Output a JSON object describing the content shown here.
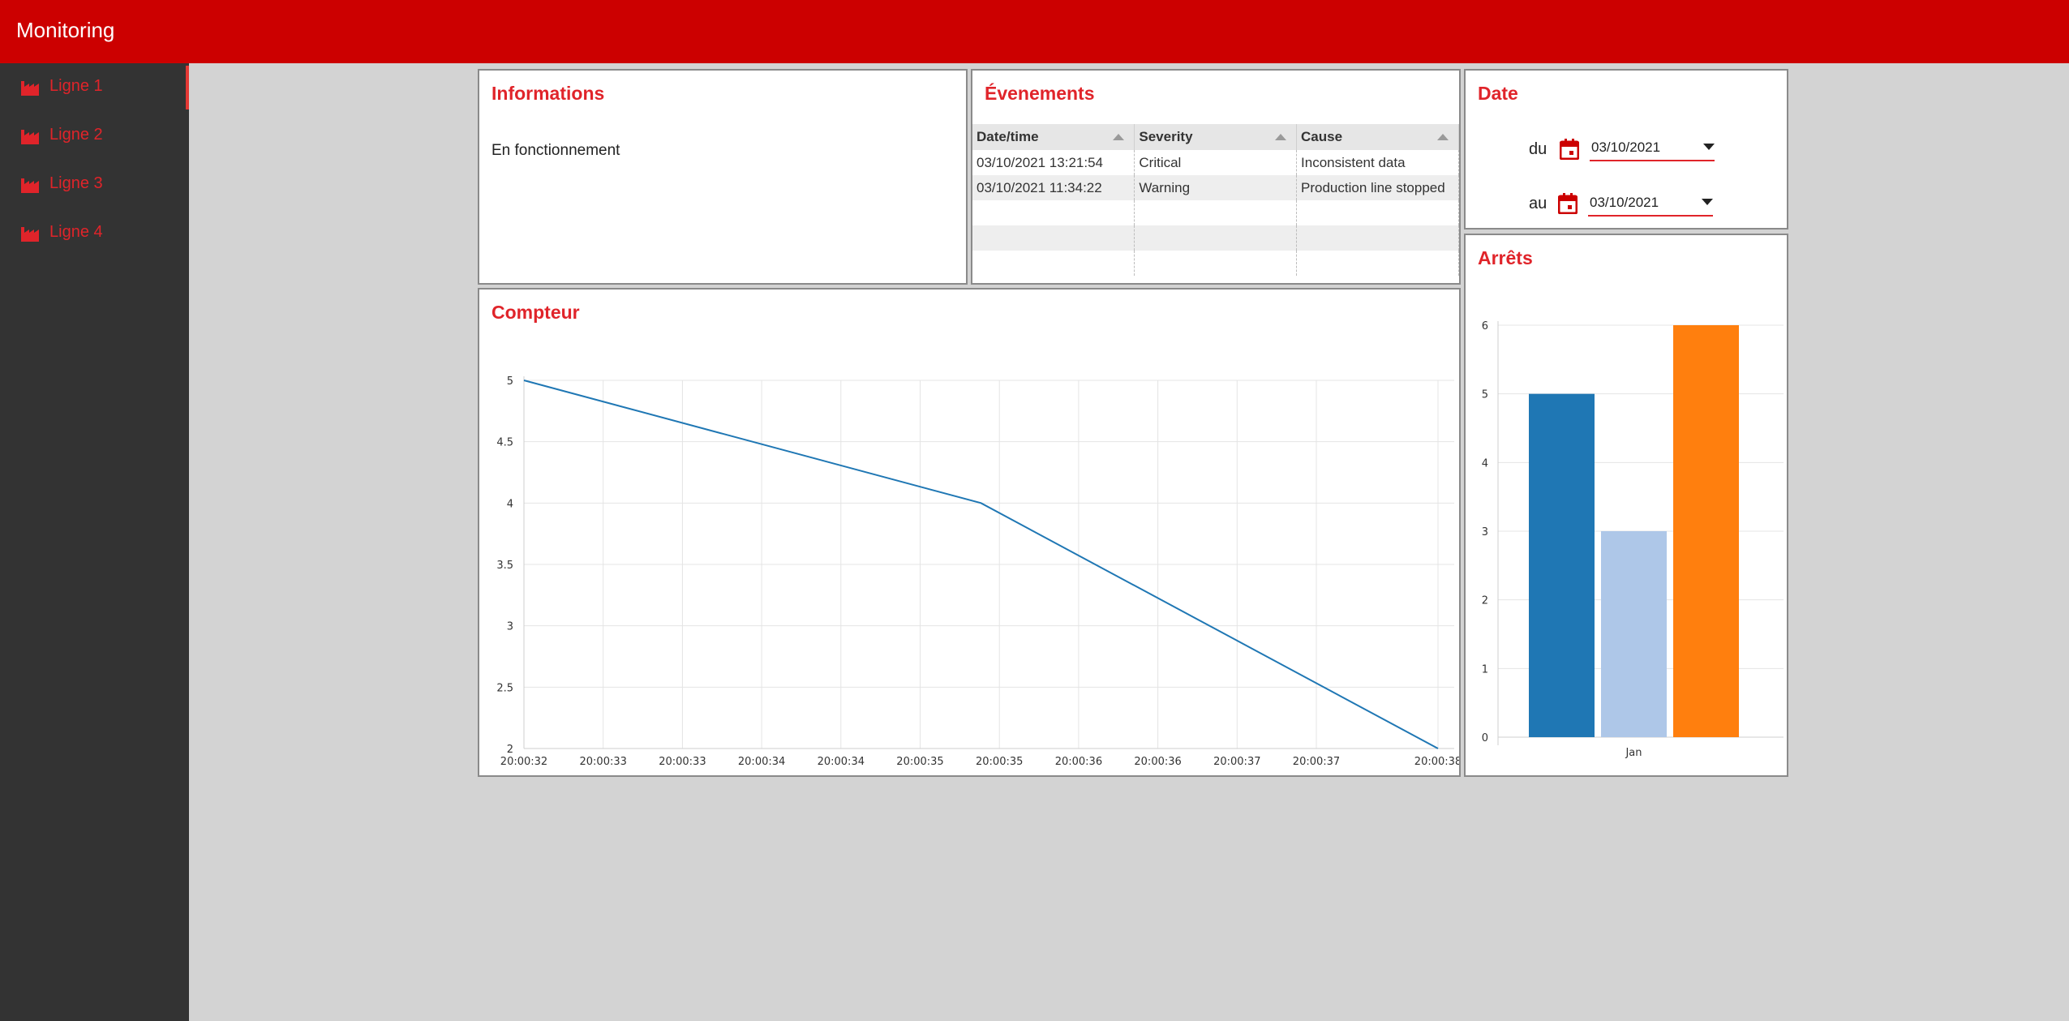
{
  "app": {
    "title": "Monitoring"
  },
  "sidebar": {
    "items": [
      {
        "label": "Ligne 1",
        "icon": "factory-icon",
        "active": true
      },
      {
        "label": "Ligne 2",
        "icon": "factory-icon",
        "active": false
      },
      {
        "label": "Ligne 3",
        "icon": "factory-icon",
        "active": false
      },
      {
        "label": "Ligne 4",
        "icon": "factory-icon",
        "active": false
      }
    ]
  },
  "colors": {
    "accent": "#e0242a",
    "header": "#cc0000",
    "sidebar": "#333333",
    "background": "#d3d3d3"
  },
  "informations": {
    "title": "Informations",
    "status": "En fonctionnement"
  },
  "evenements": {
    "title": "Évenements",
    "columns": [
      "Date/time",
      "Severity",
      "Cause"
    ],
    "rows": [
      [
        "03/10/2021 13:21:54",
        "Critical",
        "Inconsistent data"
      ],
      [
        "03/10/2021 11:34:22",
        "Warning",
        "Production line stopped"
      ]
    ]
  },
  "date": {
    "title": "Date",
    "from_label": "du",
    "from_value": "03/10/2021",
    "to_label": "au",
    "to_value": "03/10/2021"
  },
  "compteur": {
    "title": "Compteur"
  },
  "arrets": {
    "title": "Arrêts"
  },
  "chart_data": [
    {
      "type": "line",
      "x": [
        "20:00:32",
        "20:00:35",
        "20:00:38"
      ],
      "x_tick_labels": [
        "20:00:32",
        "20:00:33",
        "20:00:33",
        "20:00:34",
        "20:00:34",
        "20:00:35",
        "20:00:35",
        "20:00:36",
        "20:00:36",
        "20:00:37",
        "20:00:37",
        "20:00:38"
      ],
      "series": [
        {
          "values": [
            5,
            4,
            2
          ],
          "color": "#1f77b4"
        }
      ],
      "y_ticks": [
        "2",
        "2.5",
        "3",
        "3.5",
        "4",
        "4.5",
        "5"
      ],
      "ylim": [
        2,
        5
      ],
      "grid": true
    },
    {
      "type": "bar",
      "categories": [
        "Jan"
      ],
      "series": [
        {
          "values": [
            5
          ],
          "color": "#1f77b4"
        },
        {
          "values": [
            3
          ],
          "color": "#aec7e8"
        },
        {
          "values": [
            6
          ],
          "color": "#ff7f0e"
        }
      ],
      "y_ticks": [
        "0",
        "1",
        "2",
        "3",
        "4",
        "5",
        "6"
      ],
      "ylim": [
        0,
        6
      ],
      "grid": true
    }
  ]
}
